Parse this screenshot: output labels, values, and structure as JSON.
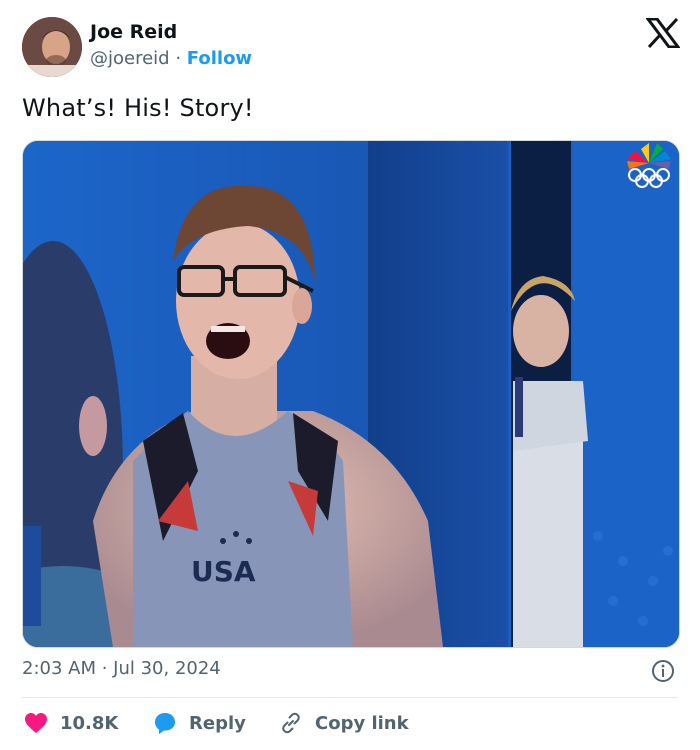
{
  "tweet": {
    "author_name": "Joe Reid",
    "author_handle": "@joereid",
    "separator": "·",
    "follow_label": "Follow",
    "text": "What’s! His! Story!",
    "timestamp": "2:03 AM · Jul 30, 2024",
    "media": {
      "jersey_text": "USA",
      "broadcaster_logo": "nbc-peacock-olympic-rings-icon"
    },
    "actions": {
      "likes_count": "10.8K",
      "reply_label": "Reply",
      "copy_link_label": "Copy link"
    }
  },
  "colors": {
    "accent": "#1d9bf0",
    "like": "#f91880",
    "text_secondary": "#536471"
  },
  "icons": [
    "x-logo-icon",
    "info-icon",
    "heart-icon",
    "reply-bubble-icon",
    "link-icon"
  ]
}
